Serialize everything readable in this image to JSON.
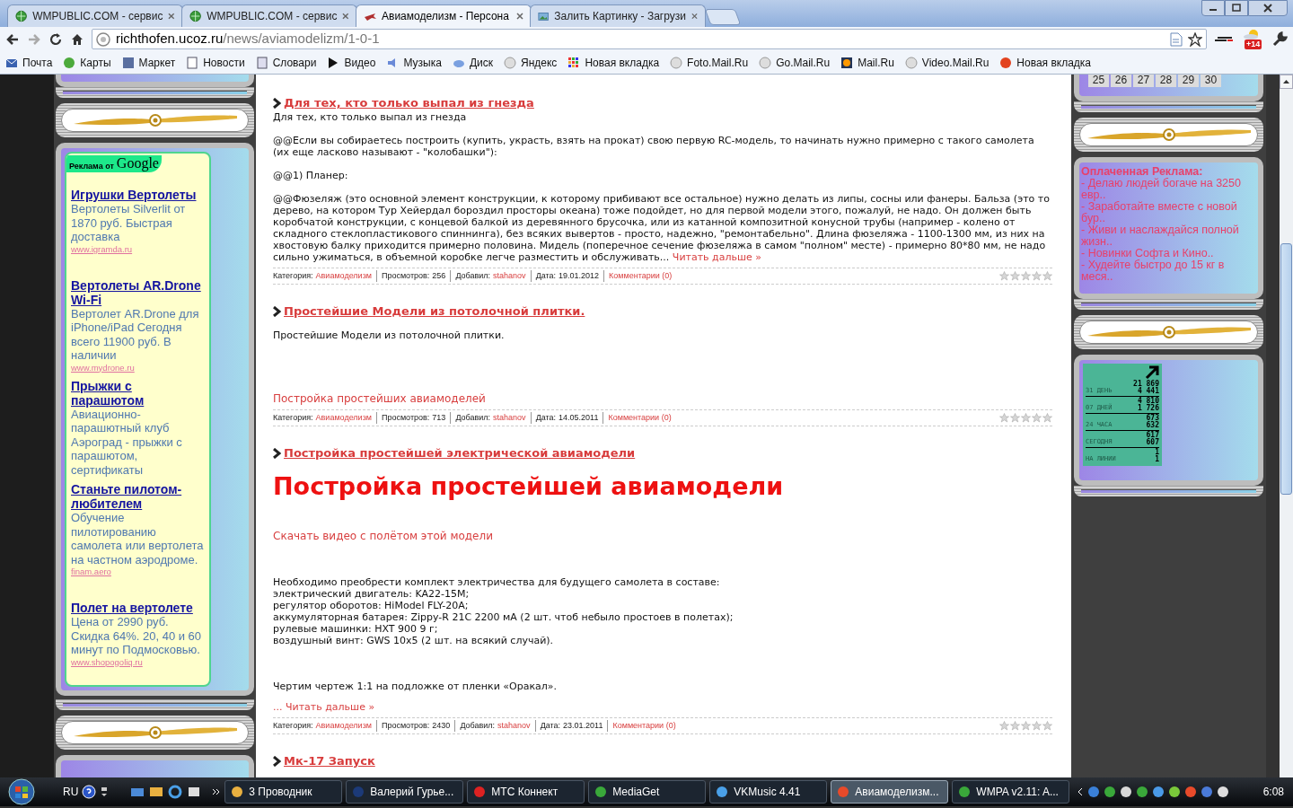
{
  "tabs": [
    {
      "title": "WMPUBLIC.COM - сервис",
      "selected": false
    },
    {
      "title": "WMPUBLIC.COM - сервис",
      "selected": false
    },
    {
      "title": "Авиамоделизм - Персона",
      "selected": true
    },
    {
      "title": "Залить Картинку - Загрузи",
      "selected": false
    }
  ],
  "address_bar": {
    "domain": "richthofen.ucoz.ru",
    "path": "/news/aviamodelizm/1-0-1"
  },
  "weather_badge": "+14",
  "bookmarks": [
    "Почта",
    "Карты",
    "Маркет",
    "Новости",
    "Словари",
    "Видео",
    "Музыка",
    "Диск",
    "Яндекс",
    "Новая вкладка",
    "Foto.Mail.Ru",
    "Go.Mail.Ru",
    "Mail.Ru",
    "Video.Mail.Ru",
    "Новая вкладка"
  ],
  "left_column": {
    "ads_label": "Реклама от",
    "ads_brand": "Google",
    "ads": [
      {
        "title": "Игрушки Вертолеты",
        "description": "Вертолеты Silverlit от 1870 руб. Быстрая доставка",
        "url": "www.igramda.ru"
      },
      {
        "title": "Вертолеты AR.Drone Wi-Fi",
        "description": "Вертолет AR.Drone для iPhone/iPad Сегодня всего 11900 руб. В наличии",
        "url": "www.mydrone.ru"
      },
      {
        "title": "Прыжки с парашютом",
        "description": "Авиационно-парашютный клуб Аэроград - прыжки с парашютом, сертификаты"
      },
      {
        "title": "Станьте пилотом-любителем",
        "description": "Обучение пилотированию самолета или вертолета на частном аэродроме.",
        "url": "finam.aero"
      },
      {
        "title": "Полет на вертолете",
        "description": "Цена от 2990 руб. Скидка 64%. 20, 40 и 60 минут по Подмосковью.",
        "url": "www.shopogoliq.ru"
      }
    ]
  },
  "posts": [
    {
      "title": "Для тех, кто только выпал из гнезда",
      "blocks": [
        {
          "kind": "text",
          "text": "Для тех, кто только выпал из гнезда"
        },
        {
          "kind": "text",
          "text": "@@Если вы собираетесь построить (купить, украсть, взять на прокат) свою первую RC-модель, то начинать нужно примерно с такого самолета (их еще ласково называют - \"колобашки\"):"
        },
        {
          "kind": "text",
          "text": "@@1) Планер:"
        },
        {
          "kind": "text",
          "text": "@@Фюзеляж (это основной элемент конструкции, к которому прибивают все остальное) нужно делать из липы, сосны или фанеры. Бальза (это то дерево, на котором Тур Хейердал бороздил просторы океана) тоже подойдет, но для первой модели этого, пожалуй, не надо. Он должен быть коробчатой конструкции, с концевой балкой из деревянного брусочка, или из катанной композитной конусной трубы (например - колено от складного стеклопластикового спиннинга), без всяких вывертов - просто, надежно, \"ремонтабельно\". Длина фюзеляжа - 1100-1300 мм, из них на хвостовую балку приходится примерно половина. Мидель (поперечное сечение фюзеляжа в самом \"полном\" месте) - примерно 80*80 мм, не надо сильно ужиматься, в объемной коробке легче разместить и обслуживать...",
          "more": "Читать дальше »"
        }
      ],
      "meta": [
        {
          "label": "Категория:",
          "value": "Авиамоделизм",
          "kind": "link"
        },
        {
          "label": "Просмотров:",
          "value": "256",
          "kind": "plain"
        },
        {
          "label": "Добавил:",
          "value": "stahanov",
          "kind": "link"
        },
        {
          "label": "Дата:",
          "value": "19.01.2012",
          "kind": "plain"
        },
        {
          "value": "Комментарии (0)",
          "kind": "link"
        }
      ],
      "stars": 0
    },
    {
      "title": "Простейшие Модели из потолочной плитки.",
      "blocks": [
        {
          "kind": "text",
          "text": "Простейшие Модели из потолочной плитки."
        },
        {
          "kind": "link",
          "text": "Постройка простейших авиамоделей"
        }
      ],
      "meta": [
        {
          "label": "Категория:",
          "value": "Авиамоделизм",
          "kind": "link"
        },
        {
          "label": "Просмотров:",
          "value": "713",
          "kind": "plain"
        },
        {
          "label": "Добавил:",
          "value": "stahanov",
          "kind": "link"
        },
        {
          "label": "Дата:",
          "value": "14.05.2011",
          "kind": "plain"
        },
        {
          "value": "Комментарии (0)",
          "kind": "link"
        }
      ],
      "stars": 0
    },
    {
      "title": "Постройка простейшей электрической авиамодели",
      "blocks": [
        {
          "kind": "heading",
          "text": "Постройка простейшей авиамодели"
        },
        {
          "kind": "link",
          "text": "Скачать видео с полётом этой модели"
        },
        {
          "kind": "list",
          "lines": [
            "Необходимо преобрести комплект электричества для будущего самолета в составе:",
            "электрический двигатель: KA22-15M;",
            "регулятор оборотов: HiModel FLY-20A;",
            "аккумуляторная батарея: Zippy-R 21C 2200 мА (2 шт. чтоб небыло простоев в полетах);",
            "рулевые машинки: HXT 900 9 г;",
            "воздушный винт: GWS 10x5 (2 шт. на всякий случай)."
          ]
        },
        {
          "kind": "text",
          "text": "Чертим чертеж 1:1 на подложке от пленки «Оракал»."
        },
        {
          "kind": "more",
          "text": "... Читать дальше »"
        }
      ],
      "meta": [
        {
          "label": "Категория:",
          "value": "Авиамоделизм",
          "kind": "link"
        },
        {
          "label": "Просмотров:",
          "value": "2430",
          "kind": "plain"
        },
        {
          "label": "Добавил:",
          "value": "stahanov",
          "kind": "link"
        },
        {
          "label": "Дата:",
          "value": "23.01.2011",
          "kind": "plain"
        },
        {
          "value": "Комментарии (0)",
          "kind": "link"
        }
      ],
      "stars": 0
    },
    {
      "title": "Мк-17 Запуск"
    }
  ],
  "right_column": {
    "calendar_days": [
      "25",
      "26",
      "27",
      "28",
      "29",
      "30"
    ],
    "paid_ads": {
      "title": "Оплаченная Реклама:",
      "items": [
        "- Делаю людей богаче на 3250 евр..",
        "- Заработайте вместе с новой бур..",
        "- Живи и наслаждайся полной жизн..",
        "- Новинки Софта и Кино..",
        "- Худейте быстро до 15 кг в меся.."
      ]
    },
    "counter": {
      "rows": [
        {
          "label": "31 ДЕНЬ",
          "values": [
            "21 869",
            "4 441"
          ]
        },
        {
          "label": "07 ДНЕЙ",
          "values": [
            "4 810",
            "1 726"
          ]
        },
        {
          "label": "24 ЧАСА",
          "values": [
            "673",
            "632"
          ]
        },
        {
          "label": "СЕГОДНЯ",
          "values": [
            "617",
            "607"
          ]
        },
        {
          "label": "НА ЛИНИИ",
          "values": [
            "1",
            "1"
          ]
        }
      ]
    }
  },
  "taskbar": {
    "language": "RU",
    "tasks": [
      {
        "label": "3 Проводник",
        "selected": false
      },
      {
        "label": "Валерий Гурье...",
        "selected": false
      },
      {
        "label": "МТС Коннект",
        "selected": false
      },
      {
        "label": "MediaGet",
        "selected": false
      },
      {
        "label": "VKMusic 4.41",
        "selected": false
      },
      {
        "label": "Авиамоделизм...",
        "selected": true
      },
      {
        "label": "WMPA v2.11: A...",
        "selected": false
      }
    ],
    "clock": "6:08"
  }
}
